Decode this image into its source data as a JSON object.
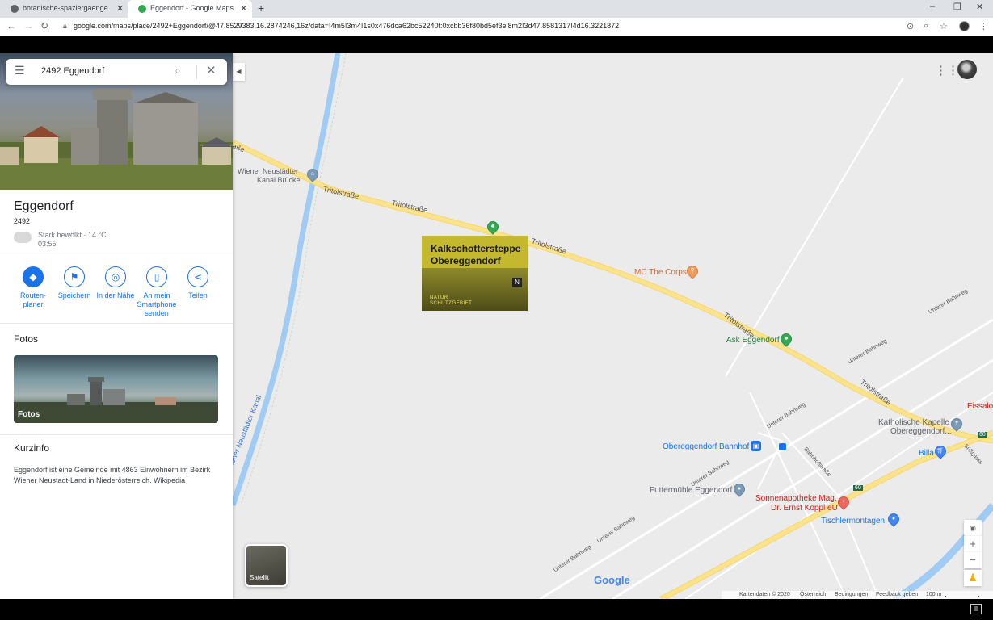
{
  "browser": {
    "tabs": [
      {
        "title": "botanische-spaziergaenge.at • Fö",
        "active": false
      },
      {
        "title": "Eggendorf - Google Maps",
        "active": true
      }
    ],
    "url": "google.com/maps/place/2492+Eggendorf/@47.8529383,16.2874246,16z/data=!4m5!3m4!1s0x476dca62bc52240f:0xcbb36f80bd5ef3el8m2!3d47.8581317!4d16.3221872"
  },
  "search": {
    "query": "2492 Eggendorf"
  },
  "place": {
    "title": "Eggendorf",
    "postcode": "2492",
    "weather": "Stark bewölkt · 14 °C",
    "time": "03:55"
  },
  "actions": [
    {
      "label": "Routen-\nplaner",
      "icon": "directions-icon"
    },
    {
      "label": "Speichern",
      "icon": "bookmark-icon"
    },
    {
      "label": "In der Nähe",
      "icon": "nearby-icon"
    },
    {
      "label": "An mein\nSmartphone\nsenden",
      "icon": "send-to-phone-icon"
    },
    {
      "label": "Teilen",
      "icon": "share-icon"
    }
  ],
  "photos": {
    "heading": "Fotos",
    "overlay": "Fotos"
  },
  "info": {
    "heading": "Kurzinfo",
    "text": "Eggendorf ist eine Gemeinde mit 4863 Einwohnern im Bezirk Wiener Neustadt-Land in Niederösterreich.",
    "link": "Wikipedia"
  },
  "map": {
    "labels": {
      "wiener_neustaedter_kanal_bruecke_1": "Wiener Neustädter",
      "wiener_neustaedter_kanal_bruecke_2": "Kanal Brücke",
      "canal": "Wiener Neustädter Kanal",
      "tritol1": "Tritolstraße",
      "tritol2": "Tritolstraße",
      "tritol3": "Tritolstraße",
      "tritol4": "Tritolstraße",
      "tritol5": "Tritolstraße",
      "mc_the_corps": "MC The Corps",
      "ask_eggendorf": "Ask Eggendorf",
      "unterer_bahnweg1": "Unterer Bahnweg",
      "unterer_bahnweg2": "Unterer Bahnweg",
      "unterer_bahnweg3": "Unterer Bahnweg",
      "unterer_bahnweg4": "Unterer Bahnweg",
      "unterer_bahnweg5": "Unterer Bahnweg",
      "unterer_bahnweg6": "Unterer Bahnweg",
      "bahnhofstrasse": "Bahnhofstraße",
      "eissalon": "Eissalon le",
      "kapelle1": "Katholische Kapelle",
      "kapelle2": "Obereggendorf...",
      "bahnhof": "Obereggendorf Bahnhof",
      "billa": "Billa",
      "futtermuehle": "Futtermühle Eggendorf",
      "apotheke1": "Sonnenapotheke Mag.",
      "apotheke2": "Dr. Ernst Köppl eU",
      "tischler": "Tischlermontagen",
      "road60a": "60",
      "road60b": "60",
      "suessgasse": "Süßgasse",
      "strasse_left": "aße"
    },
    "sign": {
      "line1": "Kalkschottersteppe",
      "line2": "Obereggendorf",
      "line3": "NATUR",
      "line4": "SCHUTZGEBIET",
      "badge": "N"
    },
    "satellite_label": "Satellit",
    "google": "Google",
    "footer": {
      "data": "Kartendaten © 2020",
      "country": "Österreich",
      "terms": "Bedingungen",
      "feedback": "Feedback geben",
      "scale": "100 m"
    },
    "colors": {
      "road": "#fbe38d",
      "water": "#9fcbf5",
      "background": "#ebebeb",
      "accent": "#1a73e8"
    }
  }
}
